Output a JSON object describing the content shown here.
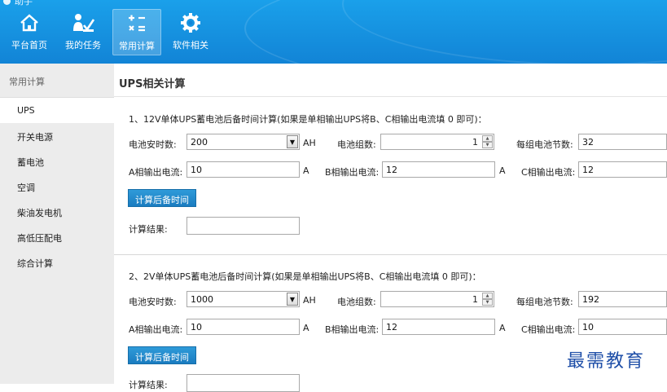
{
  "app": {
    "title": "助手"
  },
  "nav": [
    {
      "label": "平台首页",
      "icon": "home-icon"
    },
    {
      "label": "我的任务",
      "icon": "person-task-icon"
    },
    {
      "label": "常用计算",
      "icon": "calculator-icon"
    },
    {
      "label": "软件相关",
      "icon": "gear-icon"
    }
  ],
  "sidebar": {
    "header": "常用计算",
    "items": [
      "UPS",
      "开关电源",
      "蓄电池",
      "空调",
      "柴油发电机",
      "高低压配电",
      "综合计算"
    ],
    "active": "UPS"
  },
  "main": {
    "title": "UPS相关计算",
    "section1": {
      "heading": "1、12V单体UPS蓄电池后备时间计算(如果是单相输出UPS将B、C相输出电流填 0 即可)：",
      "capacity_label": "电池安时数:",
      "capacity_value": "200",
      "capacity_unit": "AH",
      "groups_label": "电池组数:",
      "groups_value": "1",
      "cells_label": "每组电池节数:",
      "cells_value": "32",
      "a_label": "A相输出电流:",
      "a_value": "10",
      "a_unit": "A",
      "b_label": "B相输出电流:",
      "b_value": "12",
      "b_unit": "A",
      "c_label": "C相输出电流:",
      "c_value": "12",
      "button": "计算后备时间",
      "result_label": "计算结果:",
      "result_value": ""
    },
    "section2": {
      "heading": "2、2V单体UPS蓄电池后备时间计算(如果是单相输出UPS将B、C相输出电流填 0 即可)：",
      "capacity_label": "电池安时数:",
      "capacity_value": "1000",
      "capacity_unit": "AH",
      "groups_label": "电池组数:",
      "groups_value": "1",
      "cells_label": "每组电池节数:",
      "cells_value": "192",
      "a_label": "A相输出电流:",
      "a_value": "10",
      "a_unit": "A",
      "b_label": "B相输出电流:",
      "b_value": "12",
      "b_unit": "A",
      "c_label": "C相输出电流:",
      "c_value": "10",
      "button": "计算后备时间",
      "result_label": "计算结果:",
      "result_value": ""
    }
  },
  "watermark": "最需教育",
  "colors": {
    "ribbon": "#1284d6",
    "button": "#1a7cc0",
    "sidebar": "#ececec"
  }
}
